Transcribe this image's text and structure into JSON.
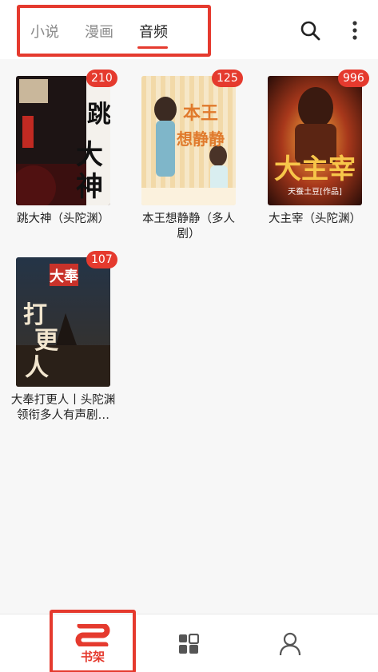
{
  "header": {
    "tabs": [
      {
        "label": "小说",
        "active": false
      },
      {
        "label": "漫画",
        "active": false
      },
      {
        "label": "音频",
        "active": true
      }
    ],
    "search_icon": "search-icon",
    "more_icon": "more-vertical-icon"
  },
  "books": [
    {
      "title": "跳大神（头陀渊）",
      "count": "210",
      "cover_text": "跳大神"
    },
    {
      "title": "本王想静静（多人剧）",
      "count": "125",
      "cover_text": "本王想静静"
    },
    {
      "title": "大主宰（头陀渊）",
      "count": "996",
      "cover_text": "大主宰",
      "cover_sub": "天蚕土豆[作品]"
    },
    {
      "title": "大奉打更人丨头陀渊领衔多人有声剧…",
      "count": "107",
      "cover_text": "打更人",
      "cover_top": "大奉"
    }
  ],
  "bottom_nav": {
    "shelf_label": "书架",
    "shelf_icon": "bookshelf-icon",
    "discover_icon": "grid-icon",
    "profile_icon": "person-icon"
  },
  "colors": {
    "accent": "#e53a2e"
  }
}
